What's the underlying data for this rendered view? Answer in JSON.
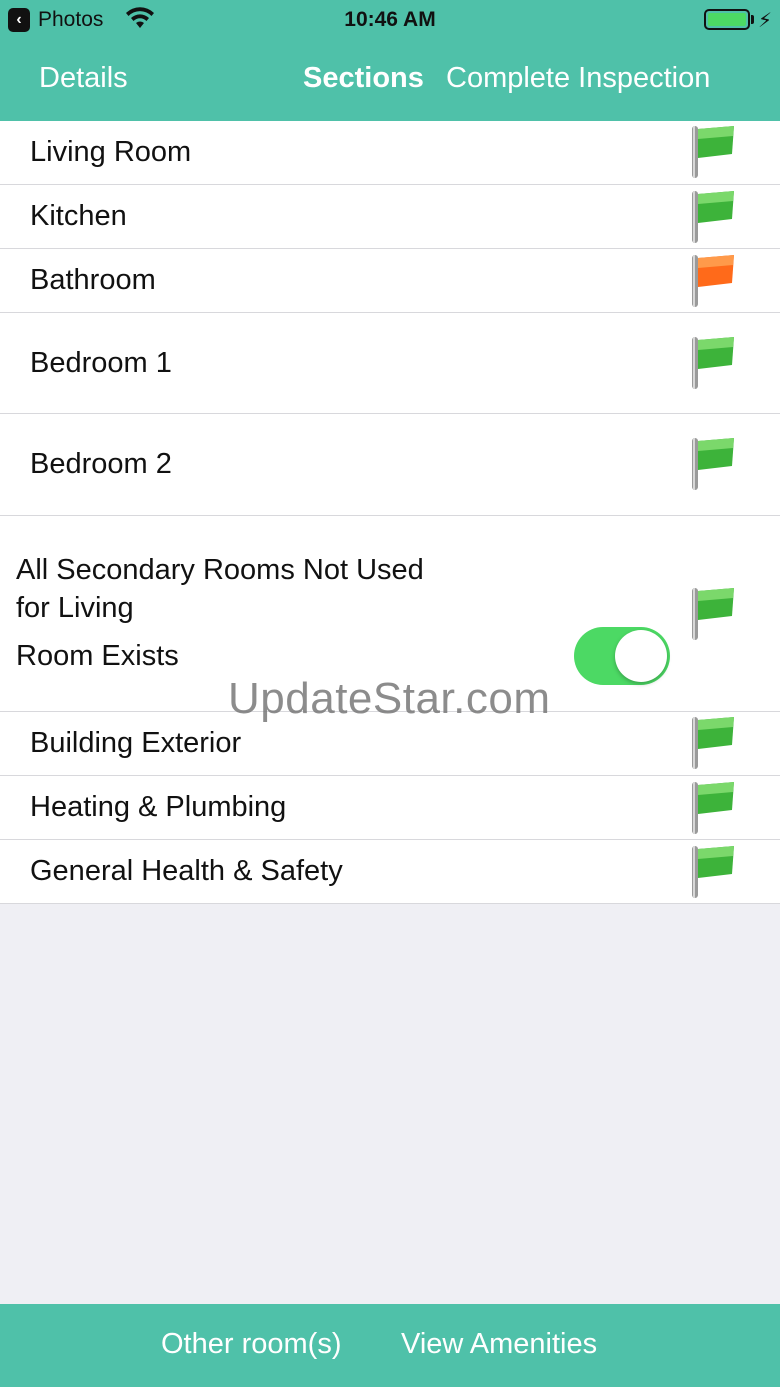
{
  "status_bar": {
    "back_app": "Photos",
    "time": "10:46 AM",
    "icons": [
      "back-arrow-icon",
      "wifi-icon",
      "battery-icon",
      "charging-bolt-icon"
    ],
    "battery_color": "#4cd964"
  },
  "nav": {
    "left": "Details",
    "title": "Sections",
    "right": "Complete Inspection",
    "color": "#4fc1a9"
  },
  "sections": [
    {
      "label": "Living Room",
      "flag": "green"
    },
    {
      "label": "Kitchen",
      "flag": "green"
    },
    {
      "label": "Bathroom",
      "flag": "orange"
    },
    {
      "label": "Bedroom 1",
      "flag": "green"
    },
    {
      "label": "Bedroom 2",
      "flag": "green"
    },
    {
      "label_line1": "All Secondary Rooms Not Used",
      "label_line2": "for Living",
      "sub_label": "Room Exists",
      "toggle_on": true,
      "flag": "green"
    },
    {
      "label": "Building Exterior",
      "flag": "green"
    },
    {
      "label": "Heating & Plumbing",
      "flag": "green"
    },
    {
      "label": "General Health & Safety",
      "flag": "green"
    }
  ],
  "flag_colors": {
    "green": "#3db33a",
    "orange": "#ff6a1a"
  },
  "watermark": "UpdateStar.com",
  "footer": {
    "other_rooms": "Other room(s)",
    "view_amenities": "View Amenities"
  }
}
